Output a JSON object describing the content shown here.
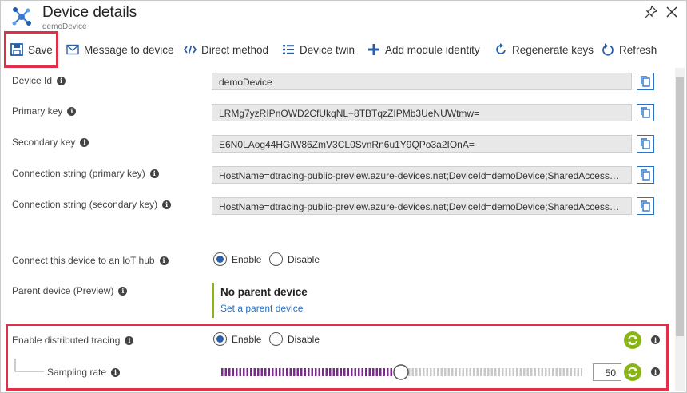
{
  "header": {
    "title": "Device details",
    "subtitle": "demoDevice"
  },
  "toolbar": {
    "save": "Save",
    "message": "Message to device",
    "direct": "Direct method",
    "twin": "Device twin",
    "module": "Add module identity",
    "regen": "Regenerate keys",
    "refresh": "Refresh"
  },
  "fields": {
    "device_id": {
      "label": "Device Id",
      "value": "demoDevice"
    },
    "primary_key": {
      "label": "Primary key",
      "value": "LRMg7yzRIPnOWD2CfUkqNL+8TBTqzZIPMb3UeNUWtmw="
    },
    "secondary_key": {
      "label": "Secondary key",
      "value": "E6N0LAog44HGiW86ZmV3CL0SvnRn6u1Y9QPo3a2IOnA="
    },
    "conn_primary": {
      "label": "Connection string (primary key)",
      "value": "HostName=dtracing-public-preview.azure-devices.net;DeviceId=demoDevice;SharedAccessKe..."
    },
    "conn_secondary": {
      "label": "Connection string (secondary key)",
      "value": "HostName=dtracing-public-preview.azure-devices.net;DeviceId=demoDevice;SharedAccessKe..."
    }
  },
  "connect": {
    "label": "Connect this device to an IoT hub",
    "enable": "Enable",
    "disable": "Disable",
    "selected": "enable"
  },
  "parent": {
    "label": "Parent device (Preview)",
    "title": "No parent device",
    "link": "Set a parent device"
  },
  "tracing": {
    "label": "Enable distributed tracing",
    "enable": "Enable",
    "disable": "Disable",
    "selected": "enable",
    "sampling_label": "Sampling rate",
    "sampling_value": "50",
    "sampling_fraction": 0.5
  },
  "colors": {
    "accent": "#2a5ea8",
    "highlight": "#e03047",
    "slider": "#7a2a8a",
    "sync": "#8ab517"
  }
}
